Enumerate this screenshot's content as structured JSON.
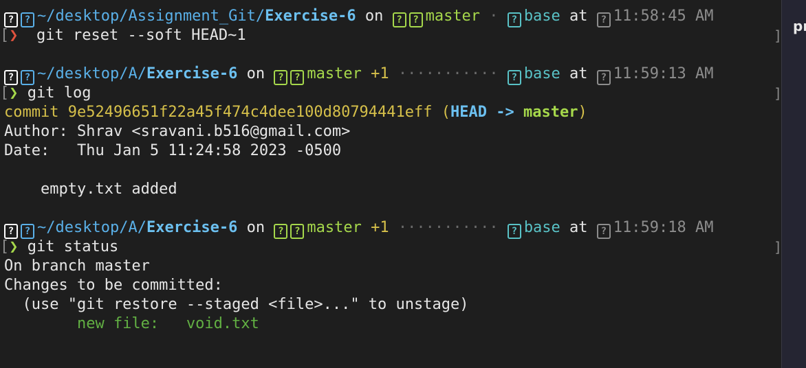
{
  "prompts": [
    {
      "path_prefix": "~/desktop/Assignment_Git/",
      "dir": "Exercise-6",
      "on": " on ",
      "branch": "master",
      "ahead": "",
      "separator": " · ",
      "env": "base",
      "at": " at ",
      "time": "11:58:45 AM",
      "symbol": "❯",
      "symbol_color": "#e0533e",
      "command": "git reset --soft HEAD~1"
    },
    {
      "path_prefix": "~/desktop/A/",
      "dir": "Exercise-6",
      "on": " on ",
      "branch": "master",
      "ahead": " +1",
      "separator": " ··········· ",
      "env": "base",
      "at": " at ",
      "time": "11:59:13 AM",
      "symbol": "❯",
      "symbol_color": "#a6d84b",
      "command": "git log"
    },
    {
      "path_prefix": "~/desktop/A/",
      "dir": "Exercise-6",
      "on": " on ",
      "branch": "master",
      "ahead": " +1",
      "separator": " ··········· ",
      "env": "base",
      "at": " at ",
      "time": "11:59:18 AM",
      "symbol": "❯",
      "symbol_color": "#a6d84b",
      "command": "git status"
    }
  ],
  "log": {
    "commit_prefix": "commit 9e52496651f22a45f474c4dee100d80794441eff (",
    "head": "HEAD -> ",
    "branch": "master",
    "close": ")",
    "author": "Author: Shrav <sravani.b516@gmail.com>",
    "date": "Date:   Thu Jan 5 11:24:58 2023 -0500",
    "message": "    empty.txt added"
  },
  "status": {
    "line1": "On branch master",
    "line2": "Changes to be committed:",
    "line3": "  (use \"git restore --staged <file>...\" to unstage)",
    "line4": "        new file:   void.txt"
  },
  "icons": {
    "os": "apple-icon",
    "folder": "folder-icon",
    "git": "git-icon",
    "branch": "branch-icon",
    "python": "python-icon",
    "clock": "clock-icon",
    "glyph": "?"
  },
  "sidebar": {
    "label": "pr"
  },
  "colors": {
    "background": "#1e1e1e",
    "path": "#5ab0e8",
    "branch": "#a6d84b",
    "ahead": "#d6c04a",
    "env": "#59c2c6",
    "time": "#8d8d8d",
    "commit": "#d6c04a",
    "staged": "#62b043"
  }
}
